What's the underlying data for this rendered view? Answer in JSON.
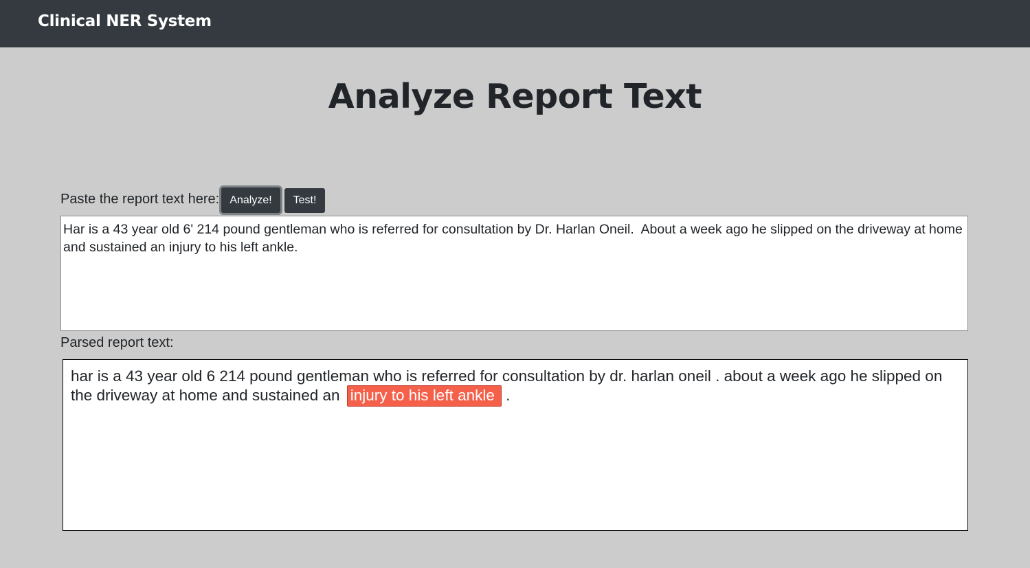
{
  "navbar": {
    "brand": "Clinical NER System"
  },
  "page": {
    "title": "Analyze Report Text"
  },
  "input": {
    "label": "Paste the report text here:",
    "analyze_button": "Analyze!",
    "test_button": "Test!",
    "value": "Har is a 43 year old 6' 214 pound gentleman who is referred for consultation by Dr. Harlan Oneil.  About a week ago he slipped on the driveway at home and sustained an injury to his left ankle."
  },
  "parsed": {
    "label": "Parsed report text:",
    "text_before": "har is a 43 year old 6 214 pound gentleman who is referred for consultation by dr. harlan oneil . about a week ago he slipped on the driveway at home and sustained an",
    "entity": "injury to his left ankle",
    "text_after": " .",
    "entity_color": "#f4604a"
  }
}
